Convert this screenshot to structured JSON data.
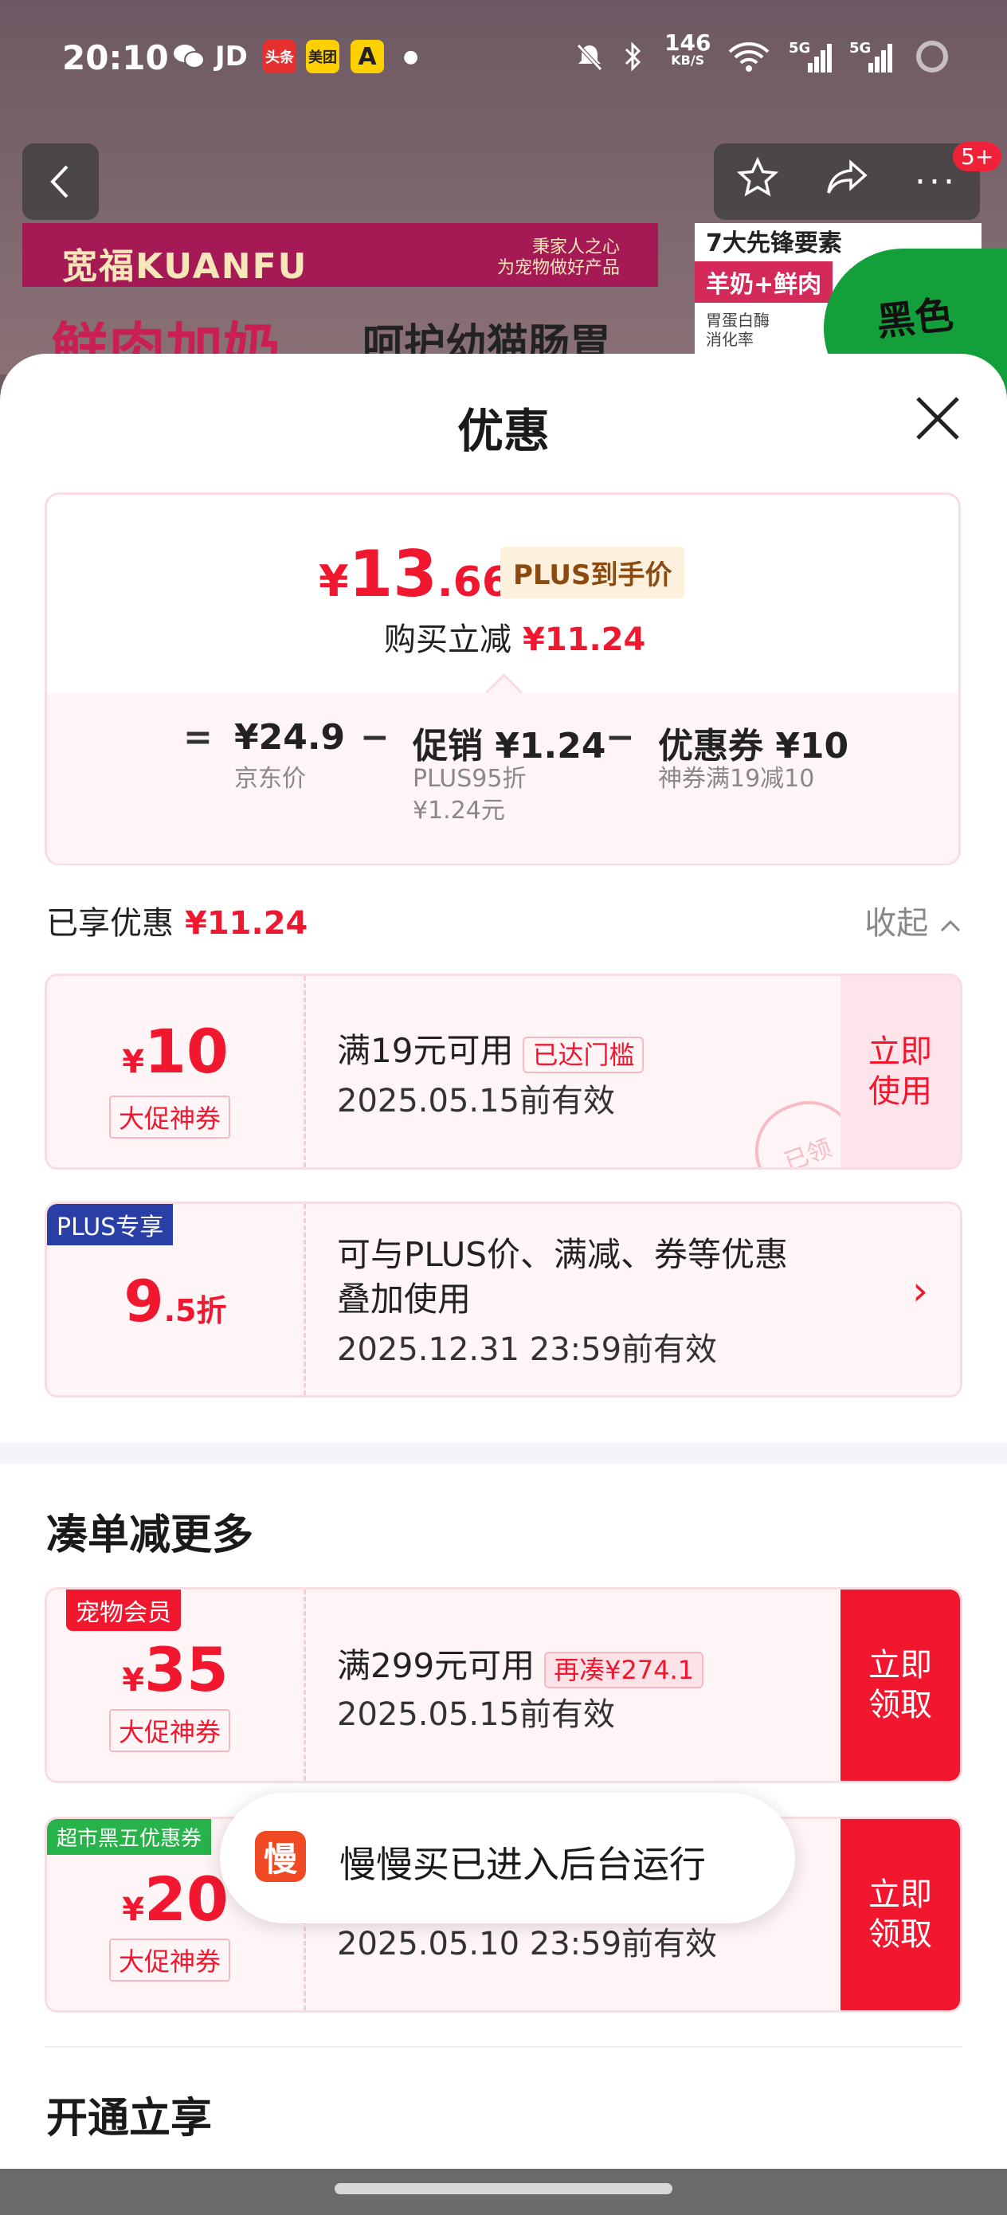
{
  "status_bar": {
    "time": "20:10",
    "app_badges": [
      "头条",
      "美团"
    ],
    "net_speed_value": "146",
    "net_speed_unit": "KB/S",
    "signal_1": "5G",
    "signal_2": "5G"
  },
  "background_page": {
    "brand": "宽福KUANFU",
    "slogan_1": "秉家人之心",
    "slogan_2": "为宠物做好产品",
    "headline": "鲜肉加奶",
    "subheadline": "呵护幼猫肠胃",
    "side_title": "7大先锋要素",
    "side_tag": "羊奶+鲜肉",
    "side_small_1": "胃蛋白酶",
    "side_small_2": "消化率",
    "green_text": "黑色",
    "cart_badge": "5+"
  },
  "sheet": {
    "title": "优惠",
    "price": {
      "yen": "¥",
      "integer": "13",
      "decimal": ".66",
      "tag": "PLUS到手价",
      "instant_label": "购买立减",
      "instant_value": "¥11.24"
    },
    "breakdown": {
      "eq": "=",
      "jd_price": "¥24.9",
      "jd_price_label": "京东价",
      "minus": "−",
      "promo": "促销 ¥1.24",
      "promo_sub_1": "PLUS95折",
      "promo_sub_2": "¥1.24元",
      "coupon": "优惠券 ¥10",
      "coupon_sub": "神券满19减10"
    },
    "enjoyed_label": "已享优惠",
    "enjoyed_value": "¥11.24",
    "collapse_label": "收起",
    "coupons": [
      {
        "yen": "¥",
        "amount": "10",
        "label": "大促神券",
        "condition": "满19元可用",
        "pill": "已达门槛",
        "validity": "2025.05.15前有效",
        "action_1": "立即",
        "action_2": "使用",
        "stamp": "已领"
      },
      {
        "ribbon": "PLUS专享",
        "amount": "9",
        "amount_suffix": ".5折",
        "condition_1": "可与PLUS价、满减、券等优惠",
        "condition_2": "叠加使用",
        "validity": "2025.12.31 23:59前有效",
        "chevron": "›"
      }
    ],
    "more_section_title": "凑单减更多",
    "more_coupons": [
      {
        "ribbon": "宠物会员",
        "yen": "¥",
        "amount": "35",
        "label": "大促神券",
        "condition": "满299元可用",
        "pill": "再凑¥274.1",
        "validity": "2025.05.15前有效",
        "action_1": "立即",
        "action_2": "领取"
      },
      {
        "ribbon": "超市黑五优惠券",
        "yen": "¥",
        "amount": "20",
        "label": "大促神券",
        "validity": "2025.05.10 23:59前有效",
        "action_1": "立即",
        "action_2": "领取"
      }
    ],
    "open_section_title": "开通立享"
  },
  "toast": {
    "icon_char": "慢",
    "text": "慢慢买已进入后台运行"
  },
  "colors": {
    "accent_red": "#f0172f",
    "plus_blue": "#2a3fa6",
    "green_ribbon": "#27b349"
  }
}
